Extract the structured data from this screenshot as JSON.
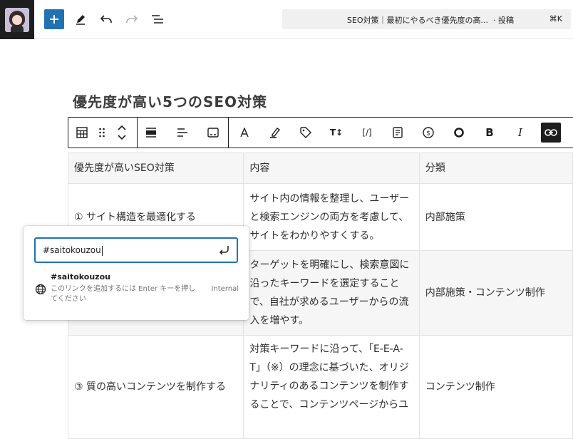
{
  "topbar": {
    "document_title": "SEO対策｜最初にやるべき優先度の高...",
    "document_type": "· 投稿",
    "shortcut": "⌘K"
  },
  "heading": "優先度が高い5つのSEO対策",
  "table": {
    "headers": [
      "優先度が高いSEO対策",
      "内容",
      "分類"
    ],
    "rows": [
      {
        "measure": "① サイト構造を最適化する",
        "content": "サイト内の情報を整理し、ユーザーと検索エンジンの両方を考慮して、サイトをわかりやすくする。",
        "category": "内部施策"
      },
      {
        "measure": "",
        "content": "ターゲットを明確にし、検索意図に沿ったキーワードを選定することで、自社が求めるユーザーからの流入を増やす。",
        "category": "内部施策・コンテンツ制作"
      },
      {
        "measure": "③ 質の高いコンテンツを制作する",
        "content": "対策キーワードに沿って、「E-E-A-T」（※）の理念に基づいた、オリジナリティのあるコンテンツを制作することで、コンテンツページからユ",
        "category": "コンテンツ制作"
      }
    ]
  },
  "link_popover": {
    "input_value": "#saitokouzou",
    "suggestion_title": "#saitokouzou",
    "suggestion_desc": "このリンクを追加するには Enter キーを押してください",
    "suggestion_type": "Internal"
  },
  "colors": {
    "accent": "#2271b1",
    "dark": "#1e1e1e",
    "row_alt": "#f6f6f6"
  }
}
